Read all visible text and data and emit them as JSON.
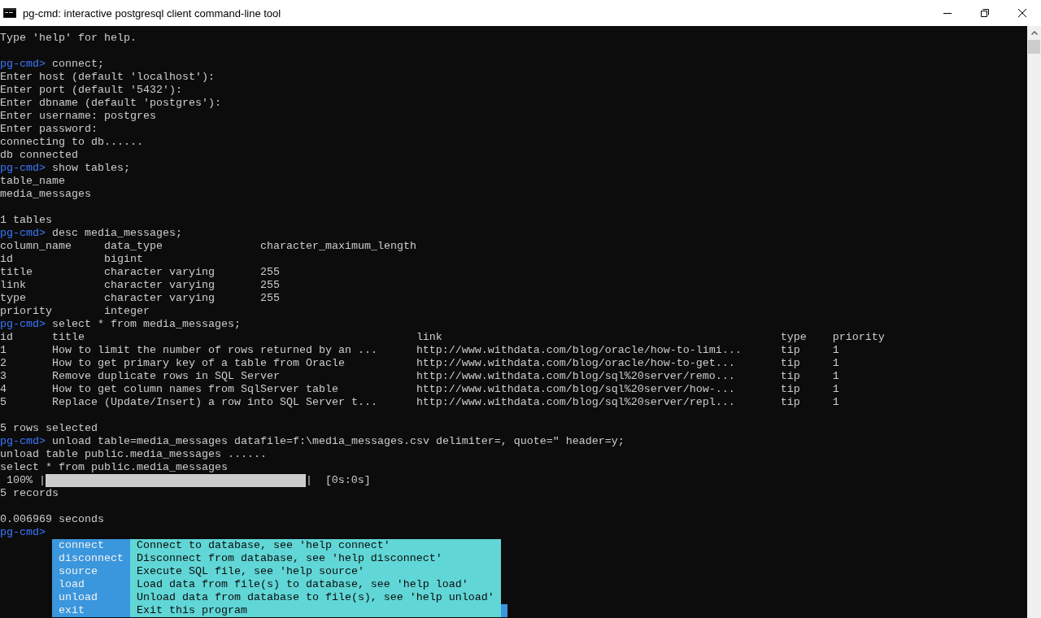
{
  "window": {
    "title": "pg-cmd: interactive postgresql client command-line tool"
  },
  "lines": [
    {
      "kind": "output",
      "text": "Type 'help' for help."
    },
    {
      "kind": "blank"
    },
    {
      "kind": "prompt",
      "prompt": "pg-cmd>",
      "command": "connect;"
    },
    {
      "kind": "output",
      "text": "Enter host (default 'localhost'):"
    },
    {
      "kind": "output",
      "text": "Enter port (default '5432'):"
    },
    {
      "kind": "output",
      "text": "Enter dbname (default 'postgres'):"
    },
    {
      "kind": "output",
      "text": "Enter username: postgres"
    },
    {
      "kind": "output",
      "text": "Enter password:"
    },
    {
      "kind": "output",
      "text": "connecting to db......"
    },
    {
      "kind": "output",
      "text": "db connected"
    },
    {
      "kind": "prompt",
      "prompt": "pg-cmd>",
      "command": "show tables;"
    },
    {
      "kind": "output",
      "text": "table_name"
    },
    {
      "kind": "output",
      "text": "media_messages"
    },
    {
      "kind": "blank"
    },
    {
      "kind": "output",
      "text": "1 tables"
    },
    {
      "kind": "prompt",
      "prompt": "pg-cmd>",
      "command": "desc media_messages;"
    },
    {
      "kind": "table",
      "rows": [
        [
          "column_name",
          "data_type",
          "character_maximum_length"
        ],
        [
          "id",
          "bigint"
        ],
        [
          "title",
          "character varying",
          "255"
        ],
        [
          "link",
          "character varying",
          "255"
        ],
        [
          "type",
          "character varying",
          "255"
        ],
        [
          "priority",
          "integer"
        ]
      ]
    },
    {
      "kind": "prompt",
      "prompt": "pg-cmd>",
      "command": "select * from media_messages;"
    },
    {
      "kind": "table",
      "rows": [
        [
          "id",
          "title",
          "link",
          "type",
          "priority"
        ],
        [
          "1",
          "How to limit the number of rows returned by an ...",
          "http://www.withdata.com/blog/oracle/how-to-limi...",
          "tip",
          "1"
        ],
        [
          "2",
          "How to get primary key of a table from Oracle",
          "http://www.withdata.com/blog/oracle/how-to-get...",
          "tip",
          "1"
        ],
        [
          "3",
          "Remove duplicate rows in SQL Server",
          "http://www.withdata.com/blog/sql%20server/remo...",
          "tip",
          "1"
        ],
        [
          "4",
          "How to get column names from SqlServer table",
          "http://www.withdata.com/blog/sql%20server/how-...",
          "tip",
          "1"
        ],
        [
          "5",
          "Replace (Update/Insert) a row into SQL Server t...",
          "http://www.withdata.com/blog/sql%20server/repl...",
          "tip",
          "1"
        ]
      ]
    },
    {
      "kind": "blank"
    },
    {
      "kind": "output",
      "text": "5 rows selected"
    },
    {
      "kind": "prompt",
      "prompt": "pg-cmd>",
      "command": "unload table=media_messages datafile=f:\\media_messages.csv delimiter=, quote=\" header=y;"
    },
    {
      "kind": "output",
      "text": "unload table public.media_messages ......"
    },
    {
      "kind": "output",
      "text": "select * from public.media_messages"
    },
    {
      "kind": "progress",
      "percent": "100%",
      "open": "|",
      "level": 1,
      "close": "|",
      "elapsed": "[0s:0s]"
    },
    {
      "kind": "output",
      "text": "5 records"
    },
    {
      "kind": "blank"
    },
    {
      "kind": "output",
      "text": "0.006969 seconds"
    },
    {
      "kind": "prompt",
      "prompt": "pg-cmd>"
    }
  ],
  "completion_menu": [
    {
      "command": "connect",
      "description": "Connect to database, see 'help connect'"
    },
    {
      "command": "disconnect",
      "description": "Disconnect from database, see 'help disconnect'"
    },
    {
      "command": "source",
      "description": "Execute SQL file, see 'help source'"
    },
    {
      "command": "load",
      "description": "Load data from file(s) to database, see 'help load'"
    },
    {
      "command": "unload",
      "description": "Unload data from database to file(s), see 'help unload'"
    },
    {
      "command": "exit",
      "description": "Exit this program"
    }
  ]
}
